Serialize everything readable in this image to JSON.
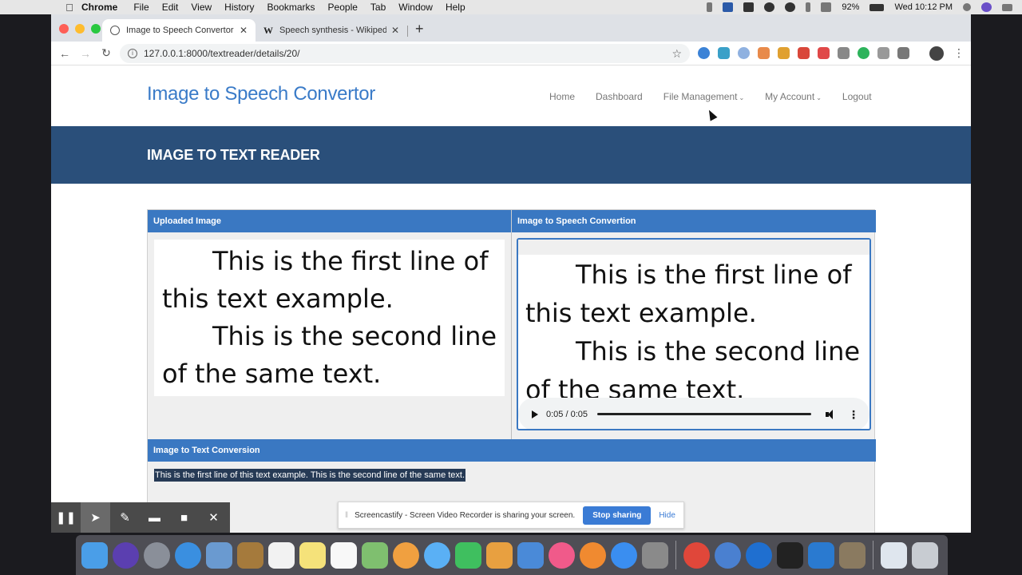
{
  "menubar": {
    "app": "Chrome",
    "items": [
      "File",
      "Edit",
      "View",
      "History",
      "Bookmarks",
      "People",
      "Tab",
      "Window",
      "Help"
    ],
    "battery": "92%",
    "clock": "Wed 10:12 PM"
  },
  "browser": {
    "tabs": [
      {
        "title": "Image to Speech Convertor",
        "active": true
      },
      {
        "title": "Speech synthesis - Wikipedia",
        "active": false
      }
    ],
    "url": "127.0.0.1:8000/textreader/details/20/"
  },
  "site": {
    "brand": "Image to Speech Convertor",
    "nav": {
      "home": "Home",
      "dashboard": "Dashboard",
      "file_management": "File Management",
      "my_account": "My Account",
      "logout": "Logout"
    },
    "banner_title": "IMAGE TO TEXT READER"
  },
  "panel": {
    "uploaded_header": "Uploaded Image",
    "speech_header": "Image to Speech Convertion",
    "conversion_header": "Image to Text Conversion",
    "image_text": {
      "line1": "This is the first line of",
      "line2": "this text example.",
      "line3": "This is the second line",
      "line4": "of the same text."
    },
    "player_text": {
      "line1": "This is the first line of",
      "line2": "this text example.",
      "line3": "This is the second line",
      "line4": "of the same text."
    },
    "audio_time": "0:05 / 0:05",
    "audio_progress": 1.0,
    "converted_text": "This is the first line of this text example. This is the second line of the same text."
  },
  "sharebar": {
    "message": "Screencastify - Screen Video Recorder is sharing your screen.",
    "stop_label": "Stop sharing",
    "hide_label": "Hide"
  },
  "colors": {
    "brand_blue": "#3a7bc8",
    "banner": "#2a4f7a",
    "panel_header": "#3a78c2"
  }
}
